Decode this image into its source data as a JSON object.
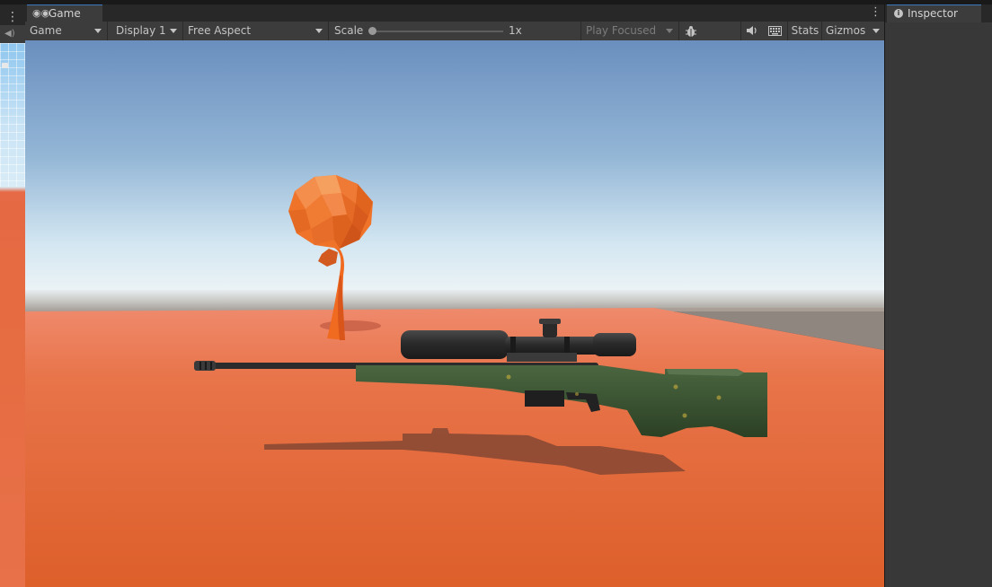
{
  "game_window": {
    "tab_label": "Game",
    "tab_icon": "gamepad-icon",
    "toolbar": {
      "mode_dropdown": "Game",
      "display_dropdown": "Display 1",
      "aspect_dropdown": "Free Aspect",
      "scale_label": "Scale",
      "scale_value": "1x",
      "play_focused_dropdown": "Play Focused",
      "bug_icon": "bug-icon",
      "audio_icon": "audio-mute-icon",
      "keyboard_icon": "keyboard-icon",
      "stats_label": "Stats",
      "gizmos_label": "Gizmos"
    }
  },
  "inspector": {
    "tab_label": "Inspector",
    "tab_icon": "info-icon"
  },
  "scene": {
    "objects": [
      "low-poly-tree",
      "sniper-rifle"
    ],
    "colors": {
      "sky_top": "#6a8fbe",
      "horizon": "#e4eff6",
      "ground": "#e36a3c",
      "tree": "#ef6a21",
      "rifle_stock": "#3a5230",
      "rifle_metal": "#2a2a2a"
    }
  },
  "colors": {
    "panel_bg": "#282828",
    "toolbar_bg": "#3c3c3c",
    "active_tab_accent": "#3a79bb",
    "text": "#c4c4c4"
  }
}
